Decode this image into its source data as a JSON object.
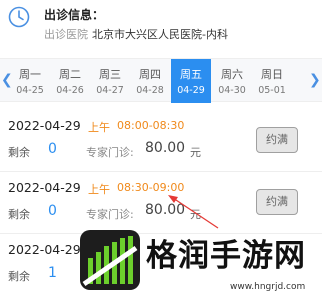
{
  "header": {
    "title": "出诊信息：",
    "hospital_label": "出诊医院",
    "hospital_value": "北京市大兴区人民医院-内科",
    "icon": "clock-icon"
  },
  "date_strip": {
    "prev_icon": "chevron-left-icon",
    "next_icon": "chevron-right-icon",
    "selected_index": 4,
    "days": [
      {
        "weekday": "周一",
        "date": "04-25"
      },
      {
        "weekday": "周二",
        "date": "04-26"
      },
      {
        "weekday": "周三",
        "date": "04-27"
      },
      {
        "weekday": "周四",
        "date": "04-28"
      },
      {
        "weekday": "周五",
        "date": "04-29"
      },
      {
        "weekday": "周六",
        "date": "04-30"
      },
      {
        "weekday": "周日",
        "date": "05-01"
      }
    ]
  },
  "slots": [
    {
      "date": "2022-04-29",
      "period": "上午",
      "time": "08:00-08:30",
      "remaining_label": "剩余",
      "remaining": "0",
      "fee_label": "专家门诊:",
      "fee": "80.00",
      "unit": "元",
      "button": "约满"
    },
    {
      "date": "2022-04-29",
      "period": "上午",
      "time": "08:30-09:00",
      "remaining_label": "剩余",
      "remaining": "0",
      "fee_label": "专家门诊:",
      "fee": "80.00",
      "unit": "元",
      "button": "约满"
    },
    {
      "date": "2022-04-29",
      "period": "",
      "time": "",
      "remaining_label": "剩余",
      "remaining": "1",
      "fee_label": "",
      "fee": "",
      "unit": "",
      "button": ""
    }
  ],
  "watermark": {
    "text": "格润手游网",
    "url": "www.hngrjd.com"
  },
  "colors": {
    "accent": "#2b8ef0",
    "time": "#f08a1c",
    "annotation": "#e53935"
  }
}
